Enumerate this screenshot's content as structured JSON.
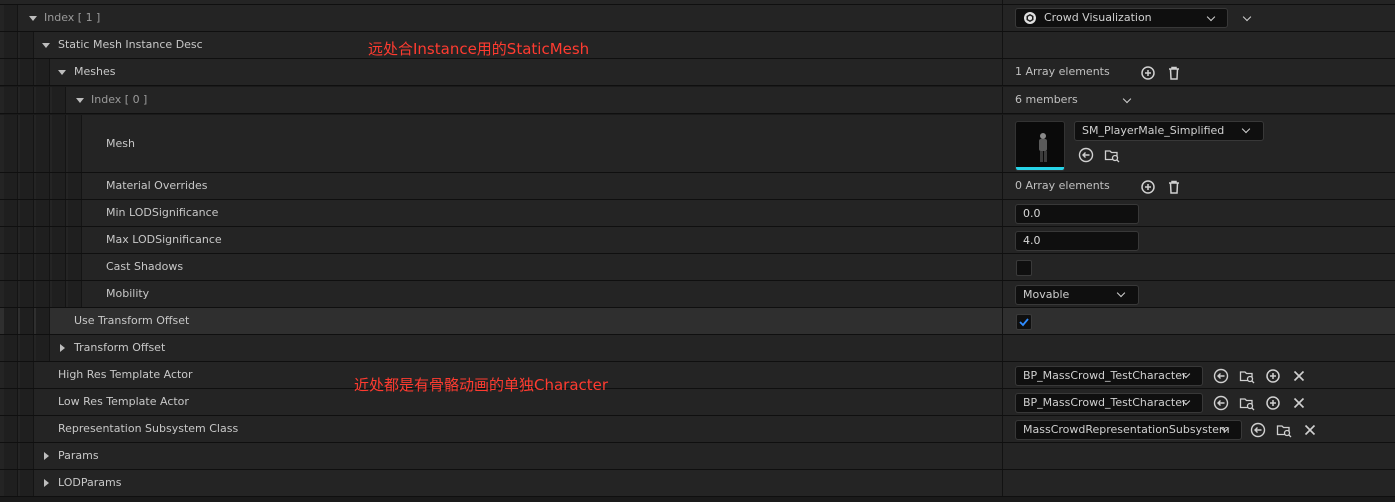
{
  "annotations": {
    "far": "远处合Instance用的StaticMesh",
    "near": "近处都是有骨骼动画的单独Character"
  },
  "rows": {
    "index1": {
      "label": "Index [ 1 ]",
      "combo": "Crowd Visualization"
    },
    "smid": {
      "label": "Static Mesh Instance Desc"
    },
    "meshes": {
      "label": "Meshes",
      "value": "1 Array elements"
    },
    "index0": {
      "label": "Index [ 0 ]",
      "value": "6 members"
    },
    "mesh": {
      "label": "Mesh",
      "combo": "SM_PlayerMale_Simplified"
    },
    "material_overrides": {
      "label": "Material Overrides",
      "value": "0 Array elements"
    },
    "min_lod": {
      "label": "Min LODSignificance",
      "value": "0.0"
    },
    "max_lod": {
      "label": "Max LODSignificance",
      "value": "4.0"
    },
    "cast_shadows": {
      "label": "Cast Shadows",
      "checked": false
    },
    "mobility": {
      "label": "Mobility",
      "combo": "Movable"
    },
    "use_transform_offset": {
      "label": "Use Transform Offset",
      "checked": true
    },
    "transform_offset": {
      "label": "Transform Offset"
    },
    "high_res": {
      "label": "High Res Template Actor",
      "combo": "BP_MassCrowd_TestCharacter"
    },
    "low_res": {
      "label": "Low Res Template Actor",
      "combo": "BP_MassCrowd_TestCharacter"
    },
    "rep_subsystem": {
      "label": "Representation Subsystem Class",
      "combo": "MassCrowdRepresentationSubsystem"
    },
    "params": {
      "label": "Params"
    },
    "lod_params": {
      "label": "LODParams"
    }
  },
  "icons": {
    "add": "plus-circle-icon",
    "delete": "trash-icon",
    "browse_back": "arrow-left-circle-icon",
    "browse_folder": "folder-search-icon",
    "clear": "close-icon",
    "check": "check-icon",
    "component": "component-icon"
  },
  "colors": {
    "annotation": "#ff3b30",
    "checkbox_check": "#2f8cff",
    "thumbnail_bar": "#27d4e8"
  }
}
